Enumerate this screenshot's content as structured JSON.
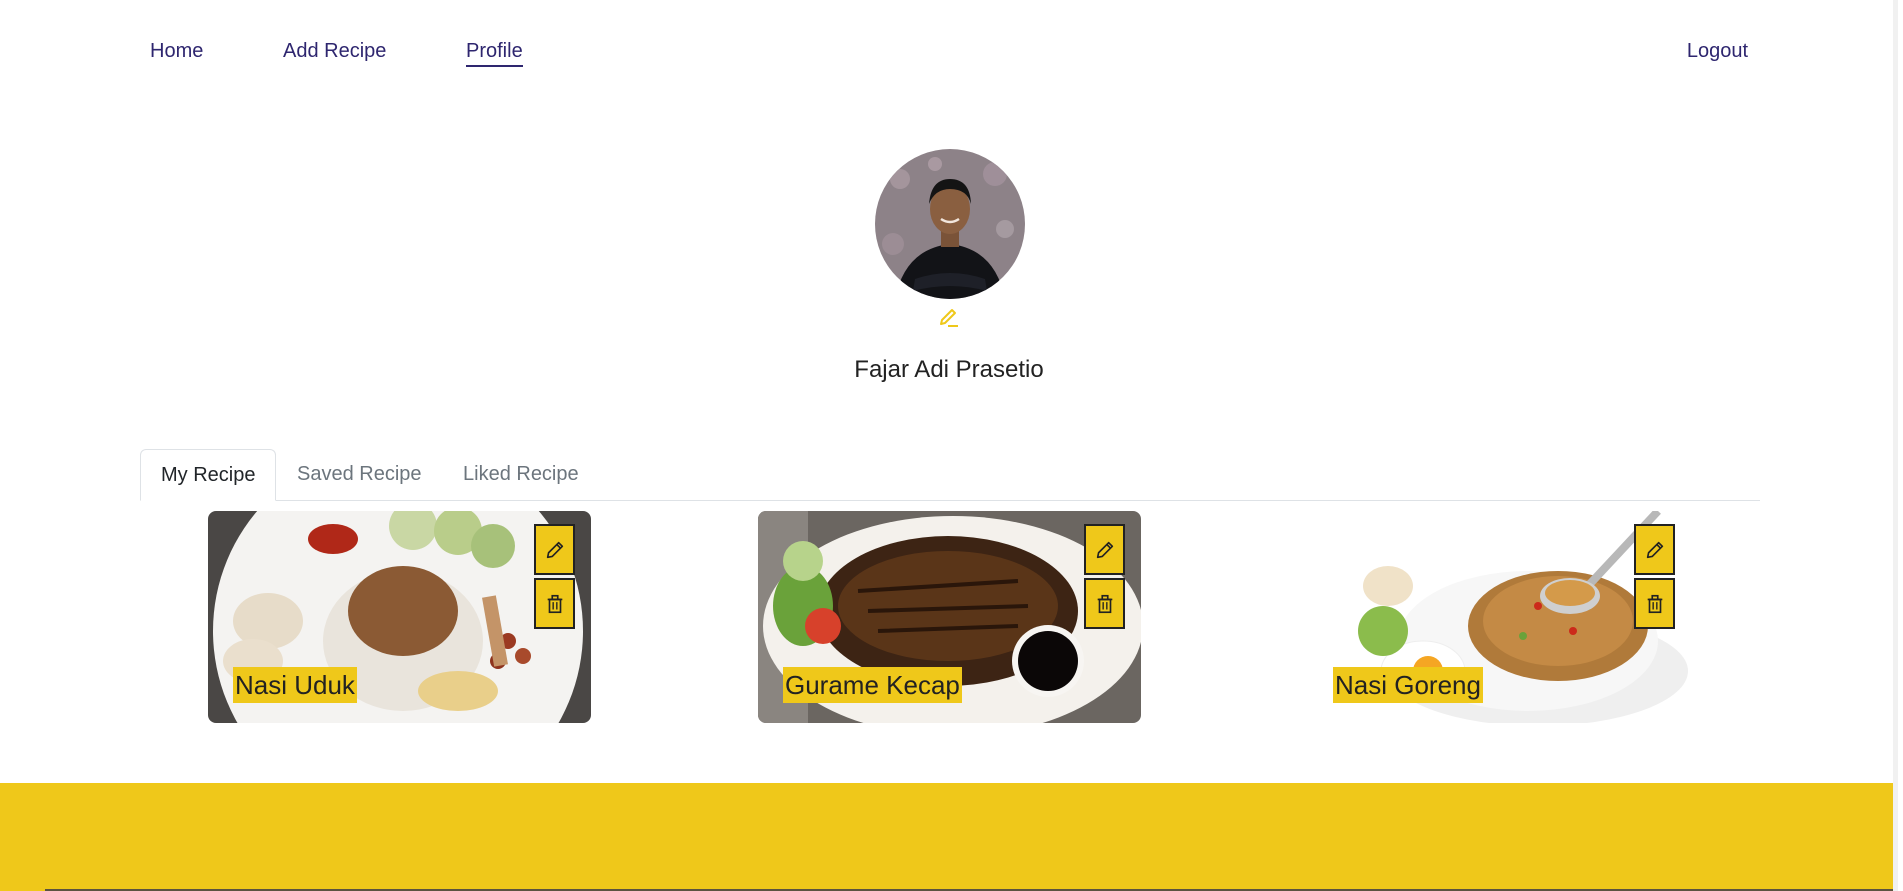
{
  "nav": {
    "home": "Home",
    "add_recipe": "Add Recipe",
    "profile": "Profile",
    "logout": "Logout"
  },
  "profile": {
    "name": "Fajar Adi Prasetio"
  },
  "tabs": [
    {
      "label": "My Recipe",
      "active": true
    },
    {
      "label": "Saved Recipe",
      "active": false
    },
    {
      "label": "Liked Recipe",
      "active": false
    }
  ],
  "recipes": [
    {
      "title": "Nasi Uduk"
    },
    {
      "title": "Gurame Kecap"
    },
    {
      "title": "Nasi Goreng"
    }
  ],
  "colors": {
    "accent": "#efc81a",
    "nav_text": "#2e266f"
  }
}
